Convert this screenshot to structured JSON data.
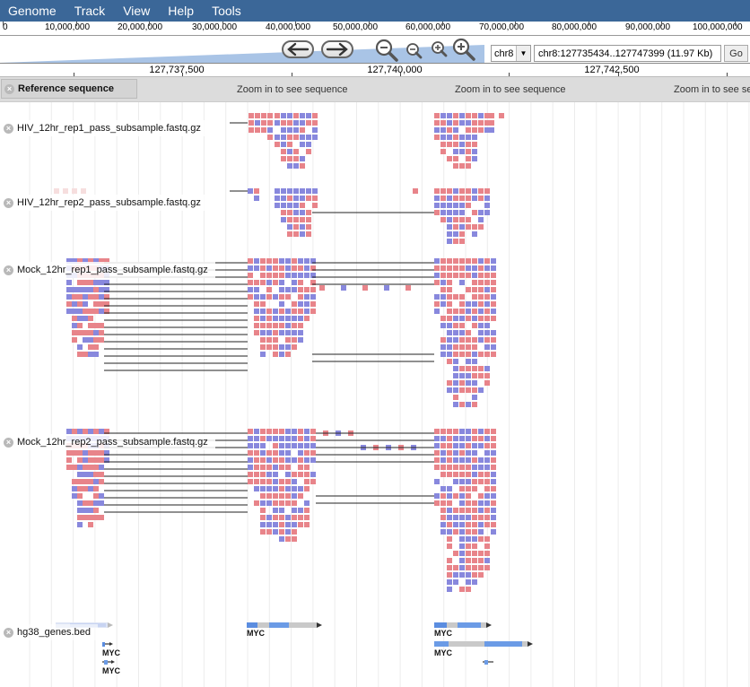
{
  "menu": [
    "Genome",
    "Track",
    "View",
    "Help",
    "Tools"
  ],
  "overview": {
    "labels": [
      "0",
      "10,000,000",
      "20,000,000",
      "30,000,000",
      "40,000,000",
      "50,000,000",
      "60,000,000",
      "70,000,000",
      "80,000,000",
      "90,000,000",
      "100,000,000"
    ]
  },
  "navigation": {
    "back_icon": "back-arrow-icon",
    "forward_icon": "forward-arrow-icon",
    "zoom_icons": [
      "zoom-out-large-icon",
      "zoom-out-small-icon",
      "zoom-in-small-icon",
      "zoom-in-large-icon"
    ],
    "reference": "chr8",
    "location": "chr8:127735434..127747399 (11.97 Kb)",
    "go_label": "Go"
  },
  "scale": {
    "labels": [
      "127,737,500",
      "127,740,000",
      "127,742,500"
    ]
  },
  "reference_track": {
    "label": "Reference sequence",
    "behind_text": "nce",
    "zoom_message": "Zoom in to see sequence"
  },
  "tracks": [
    {
      "label": "HIV_12hr_rep1_pass_subsample.fastq.gz"
    },
    {
      "label": "HIV_12hr_rep2_pass_subsample.fastq.gz"
    },
    {
      "label": "Mock_12hr_rep1_pass_subsample.fastq.gz"
    },
    {
      "label": "Mock_12hr_rep2_pass_subsample.fastq.gz"
    }
  ],
  "gene_track": {
    "label": "hg38_genes.bed",
    "features": [
      {
        "name": "MYC"
      },
      {
        "name": "MYC"
      },
      {
        "name": "MYC"
      },
      {
        "name": "MYC"
      },
      {
        "name": "MYC"
      }
    ]
  },
  "colors": {
    "menubar": "#3b6798",
    "forward_read": "#e8848a",
    "reverse_read": "#8888dd",
    "zoom_bg": "#dcdcdc"
  }
}
